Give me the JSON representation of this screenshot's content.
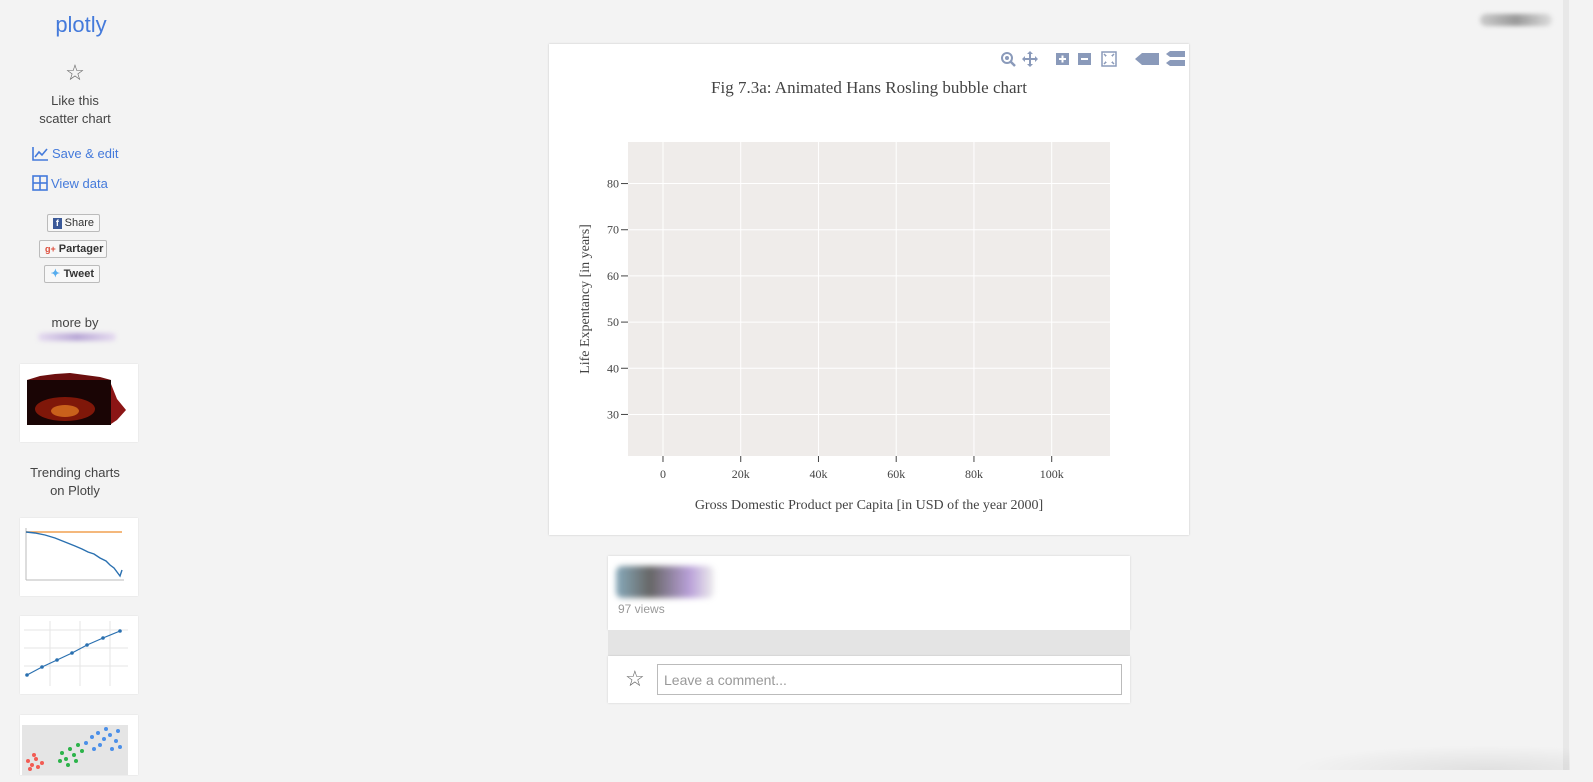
{
  "sidebar": {
    "logo": "plotly",
    "like_line1": "Like this",
    "like_line2": "scatter chart",
    "save_edit": "Save & edit",
    "view_data": "View data",
    "share_fb": "Share",
    "share_gplus": "Partager",
    "share_tweet": "Tweet",
    "more_by": "more by",
    "trending_line1": "Trending charts",
    "trending_line2": "on Plotly"
  },
  "modebar": {
    "icons": [
      "zoom-icon",
      "pan-icon",
      "zoom-in-icon",
      "zoom-out-icon",
      "autoscale-icon",
      "hover-closest-icon",
      "hover-compare-icon"
    ]
  },
  "chart_data": {
    "type": "scatter",
    "title": "Fig 7.3a: Animated Hans Rosling bubble chart",
    "xlabel": "Gross Domestic Product per Capita [in USD of the year 2000]",
    "ylabel": "Life Expentancy [in years]",
    "xlim": [
      -9000,
      115000
    ],
    "ylim": [
      21,
      89
    ],
    "xticks": [
      0,
      20000,
      40000,
      60000,
      80000,
      100000
    ],
    "xtick_labels": [
      "0",
      "20k",
      "40k",
      "60k",
      "80k",
      "100k"
    ],
    "yticks": [
      30,
      40,
      50,
      60,
      70,
      80
    ],
    "ytick_labels": [
      "30",
      "40",
      "50",
      "60",
      "70",
      "80"
    ],
    "grid": true,
    "series": [],
    "colors": {
      "plot_bg": "#efecea",
      "grid": "#ffffff",
      "text": "#444444"
    }
  },
  "post": {
    "views": "97 views",
    "comment_placeholder": "Leave a comment..."
  }
}
